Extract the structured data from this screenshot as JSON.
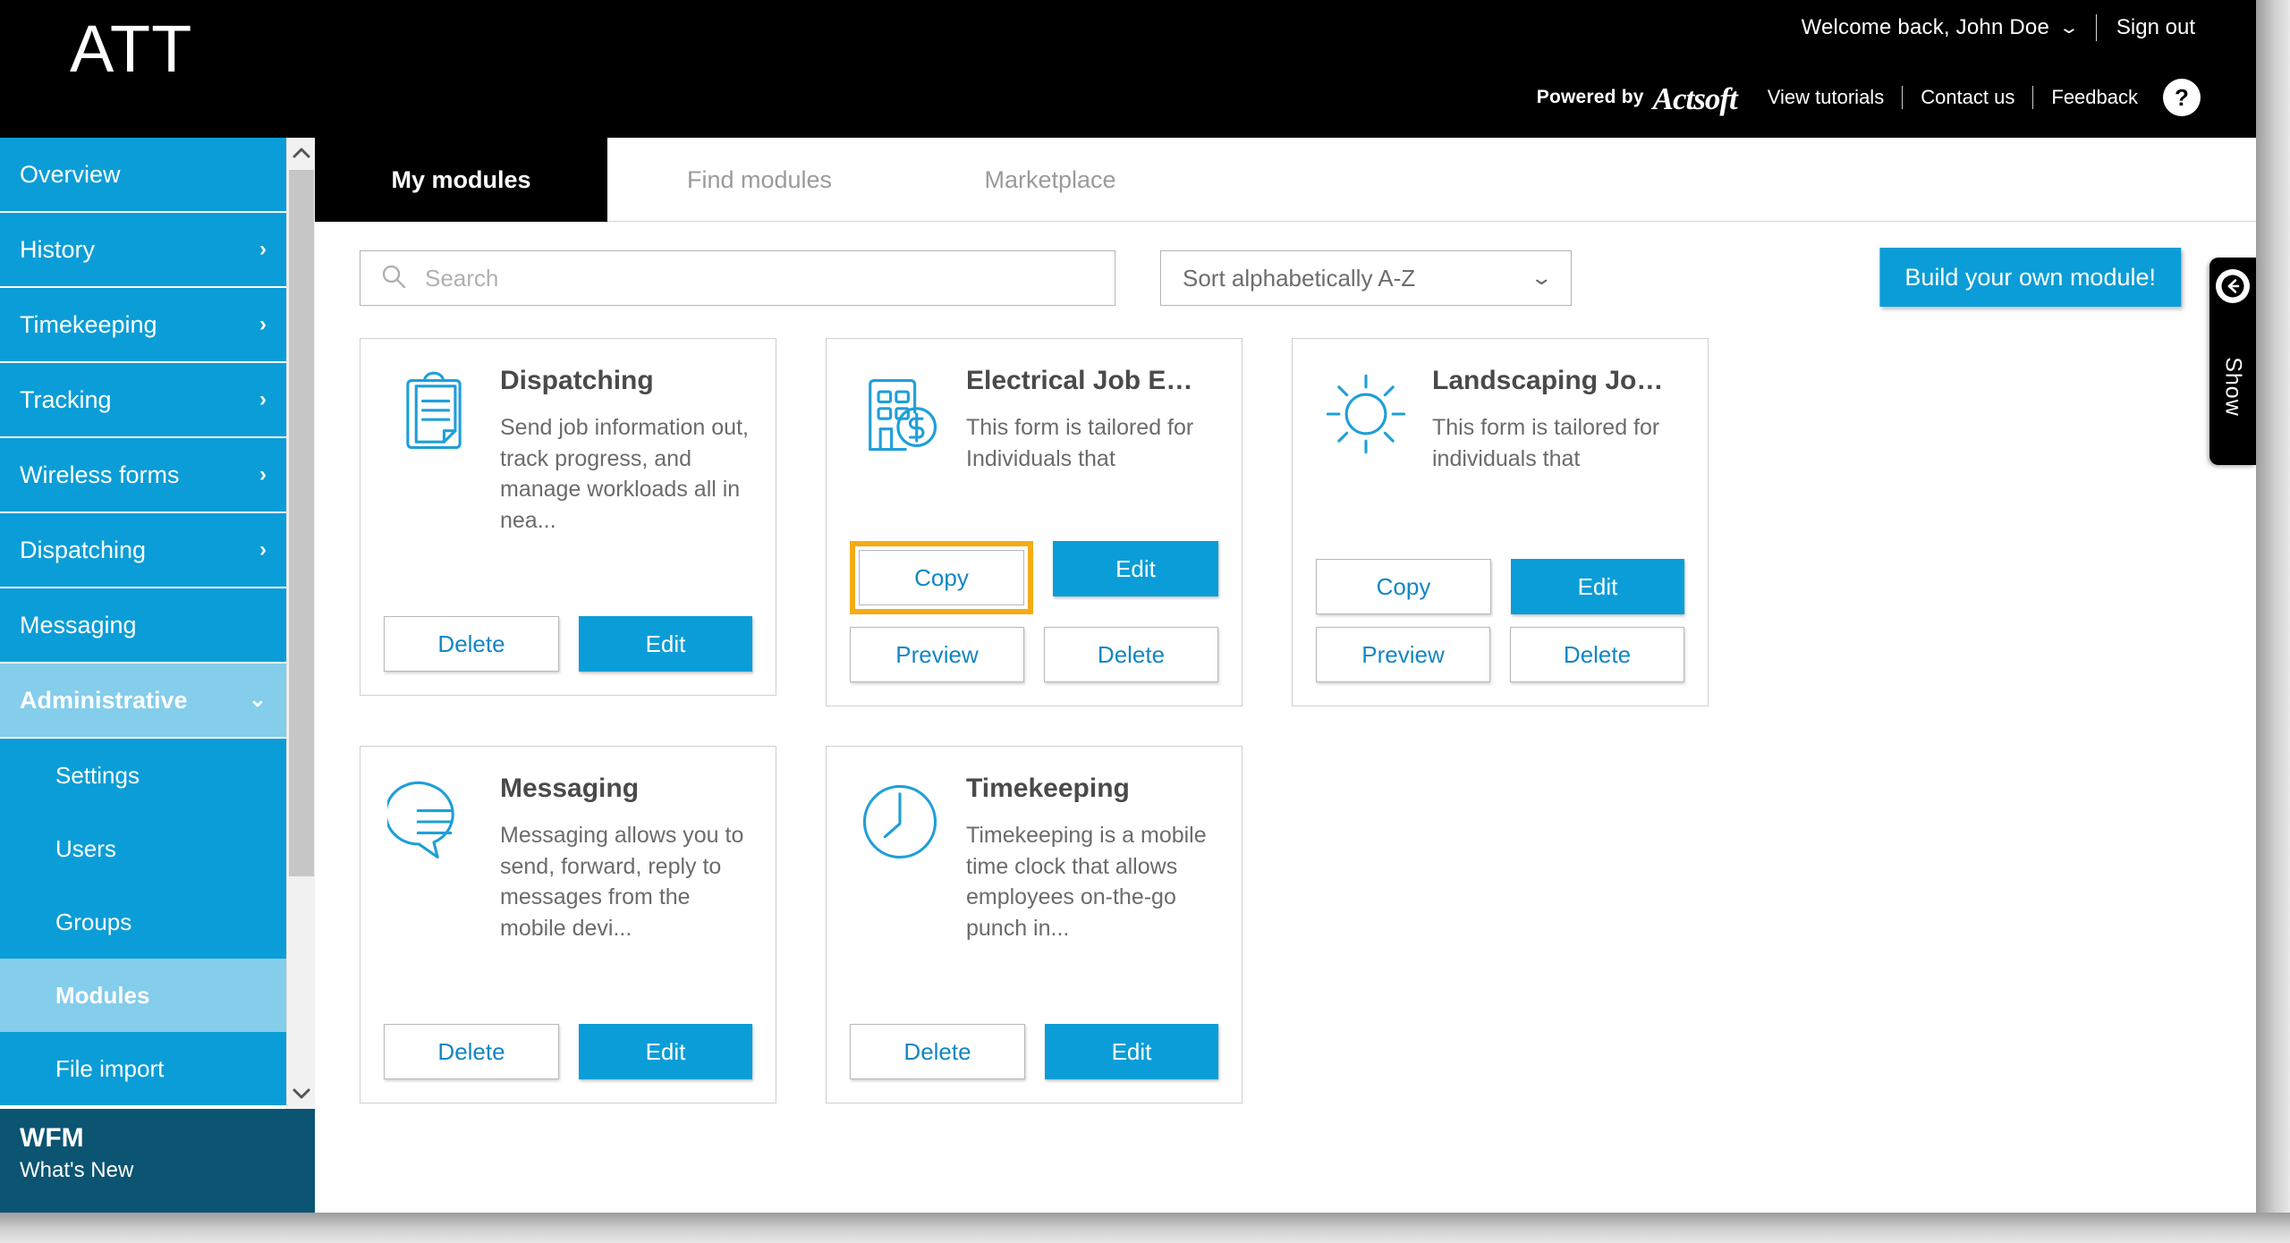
{
  "header": {
    "brand": "ATT",
    "welcome_text": "Welcome back, John Doe",
    "welcome_caret_icon": "chevron-down-icon",
    "sign_out": "Sign out",
    "powered_by": "Powered by",
    "powered_by_brand": "Actsoft",
    "links": [
      {
        "label": "View tutorials"
      },
      {
        "label": "Contact us"
      },
      {
        "label": "Feedback"
      }
    ],
    "help_badge": "?"
  },
  "sidebar": {
    "items": [
      {
        "label": "Overview",
        "chevron": "",
        "state": "normal"
      },
      {
        "label": "History",
        "chevron": "›",
        "state": "normal"
      },
      {
        "label": "Timekeeping",
        "chevron": "›",
        "state": "normal"
      },
      {
        "label": "Tracking",
        "chevron": "›",
        "state": "normal"
      },
      {
        "label": "Wireless forms",
        "chevron": "›",
        "state": "normal"
      },
      {
        "label": "Dispatching",
        "chevron": "›",
        "state": "normal"
      },
      {
        "label": "Messaging",
        "chevron": "",
        "state": "normal"
      },
      {
        "label": "Administrative",
        "chevron": "⌄",
        "state": "expanded"
      }
    ],
    "sub_items": [
      {
        "label": "Settings",
        "state": "normal"
      },
      {
        "label": "Users",
        "state": "normal"
      },
      {
        "label": "Groups",
        "state": "normal"
      },
      {
        "label": "Modules",
        "state": "active"
      },
      {
        "label": "File import",
        "state": "normal"
      }
    ],
    "footer": {
      "title": "WFM",
      "subtitle": "What's New"
    },
    "scroll_up_icon": "chevron-up-icon",
    "scroll_down_icon": "chevron-down-icon"
  },
  "main": {
    "tabs": [
      {
        "label": "My modules",
        "active": true
      },
      {
        "label": "Find modules",
        "active": false
      },
      {
        "label": "Marketplace",
        "active": false
      }
    ],
    "toolbar": {
      "search_placeholder": "Search",
      "search_value": "",
      "search_icon": "search-icon",
      "sort_value": "Sort alphabetically A-Z",
      "sort_caret_icon": "chevron-down-icon",
      "build_button": "Build your own module!"
    },
    "cards": [
      {
        "title": "Dispatching",
        "description": "Send job information out, track progress, and manage workloads all in nea...",
        "icon": "clipboard-icon",
        "buttons": [
          {
            "label": "Delete",
            "style": "secondary",
            "highlighted": false
          },
          {
            "label": "Edit",
            "style": "primary",
            "highlighted": false
          }
        ]
      },
      {
        "title": "Electrical Job E…",
        "description": "This form is tailored for Individuals that",
        "icon": "building-dollar-icon",
        "buttons": [
          {
            "label": "Copy",
            "style": "secondary",
            "highlighted": true
          },
          {
            "label": "Edit",
            "style": "primary",
            "highlighted": false
          },
          {
            "label": "Preview",
            "style": "secondary",
            "highlighted": false
          },
          {
            "label": "Delete",
            "style": "secondary",
            "highlighted": false
          }
        ]
      },
      {
        "title": "Landscaping Jo…",
        "description": "This form is tailored for individuals that",
        "icon": "sun-icon",
        "buttons": [
          {
            "label": "Copy",
            "style": "secondary",
            "highlighted": false
          },
          {
            "label": "Edit",
            "style": "primary",
            "highlighted": false
          },
          {
            "label": "Preview",
            "style": "secondary",
            "highlighted": false
          },
          {
            "label": "Delete",
            "style": "secondary",
            "highlighted": false
          }
        ]
      },
      {
        "title": "Messaging",
        "description": "Messaging allows you to send, forward, reply to messages from the mobile devi...",
        "icon": "chat-bubble-icon",
        "buttons": [
          {
            "label": "Delete",
            "style": "secondary",
            "highlighted": false
          },
          {
            "label": "Edit",
            "style": "primary",
            "highlighted": false
          }
        ]
      },
      {
        "title": "Timekeeping",
        "description": "Timekeeping is a mobile time clock that allows employees on-the-go punch in...",
        "icon": "clock-icon",
        "buttons": [
          {
            "label": "Delete",
            "style": "secondary",
            "highlighted": false
          },
          {
            "label": "Edit",
            "style": "primary",
            "highlighted": false
          }
        ]
      }
    ],
    "show_panel": {
      "label": "Show",
      "icon": "arrow-left-circle-icon"
    }
  },
  "colors": {
    "brand_blue": "#0b9dd7",
    "sidebar_active": "#84cdeb",
    "footer_navy": "#0b5472",
    "highlight_orange": "#f5ab16",
    "header_black": "#000000",
    "link_blue": "#1386c4"
  }
}
